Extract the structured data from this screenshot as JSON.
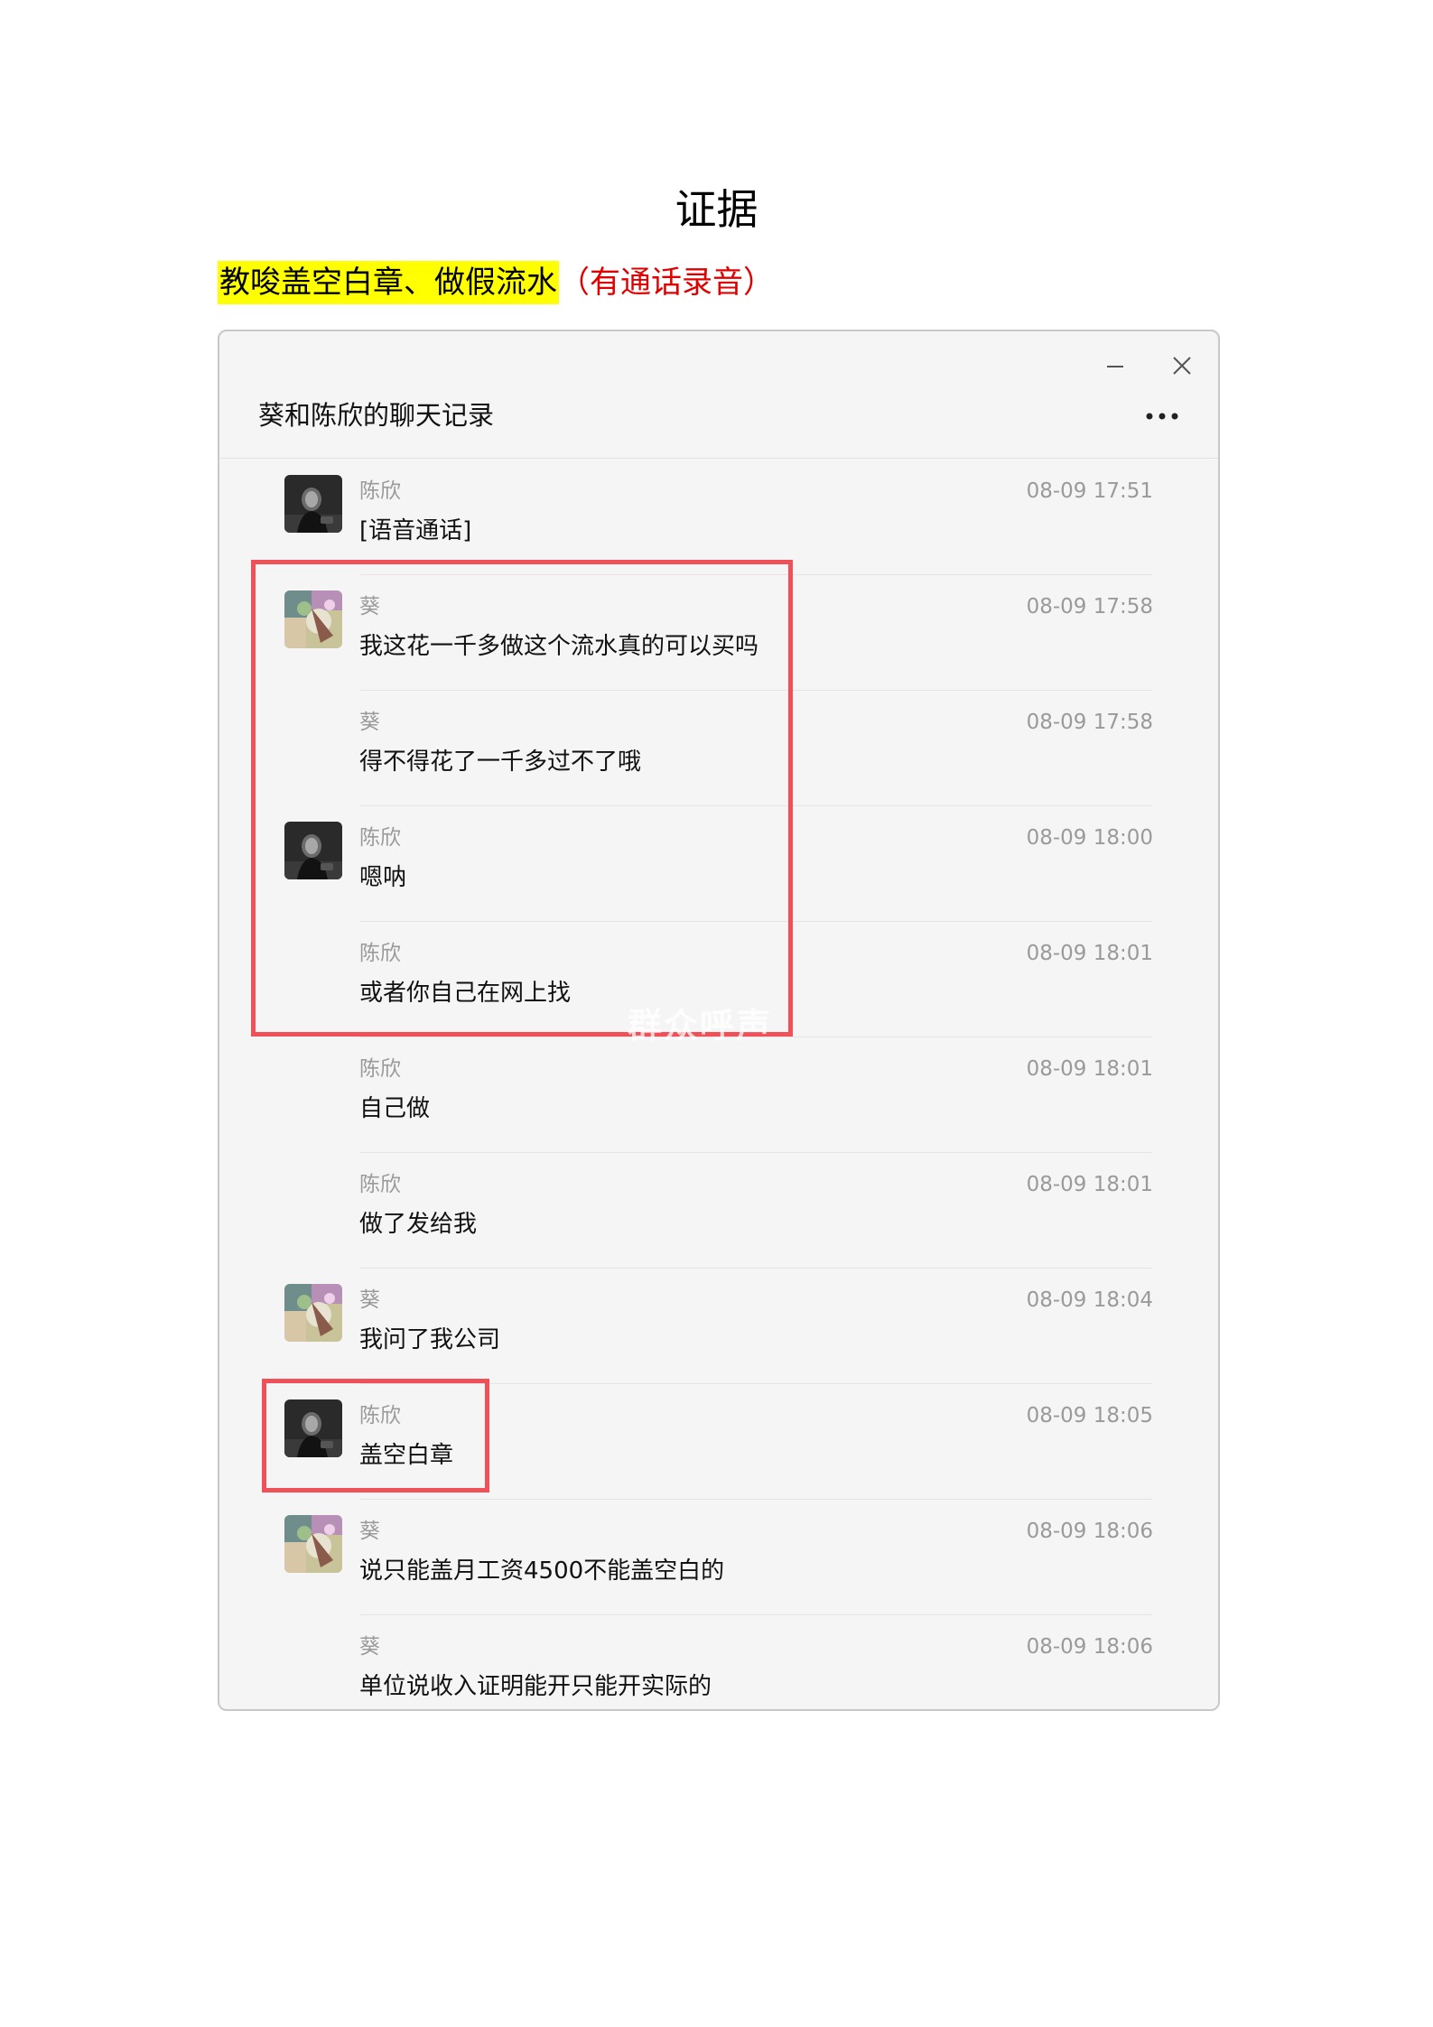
{
  "document": {
    "title": "证据",
    "caption_highlight": "教唆盖空白章、做假流水",
    "caption_note": "（有通话录音）"
  },
  "window": {
    "title": "葵和陈欣的聊天记录",
    "minimize_icon": "minimize-icon",
    "close_icon": "close-icon",
    "more_icon": "more-horizontal-icon"
  },
  "messages": [
    {
      "sender": "陈欣",
      "time": "08-09 17:51",
      "text": "[语音通话]",
      "avatar": "chenxin"
    },
    {
      "sender": "葵",
      "time": "08-09 17:58",
      "text": "我这花一千多做这个流水真的可以买吗",
      "avatar": "kui"
    },
    {
      "sender": "葵",
      "time": "08-09 17:58",
      "text": "得不得花了一千多过不了哦",
      "avatar": ""
    },
    {
      "sender": "陈欣",
      "time": "08-09 18:00",
      "text": "嗯呐",
      "avatar": "chenxin"
    },
    {
      "sender": "陈欣",
      "time": "08-09 18:01",
      "text": "或者你自己在网上找",
      "avatar": ""
    },
    {
      "sender": "陈欣",
      "time": "08-09 18:01",
      "text": "自己做",
      "avatar": ""
    },
    {
      "sender": "陈欣",
      "time": "08-09 18:01",
      "text": "做了发给我",
      "avatar": ""
    },
    {
      "sender": "葵",
      "time": "08-09 18:04",
      "text": "我问了我公司",
      "avatar": "kui"
    },
    {
      "sender": "陈欣",
      "time": "08-09 18:05",
      "text": "盖空白章",
      "avatar": "chenxin"
    },
    {
      "sender": "葵",
      "time": "08-09 18:06",
      "text": "说只能盖月工资4500不能盖空白的",
      "avatar": "kui"
    },
    {
      "sender": "葵",
      "time": "08-09 18:06",
      "text": "单位说收入证明能开只能开实际的",
      "avatar": ""
    }
  ],
  "annotations": {
    "box_color": "#f05058",
    "watermark": "群众呼声"
  }
}
